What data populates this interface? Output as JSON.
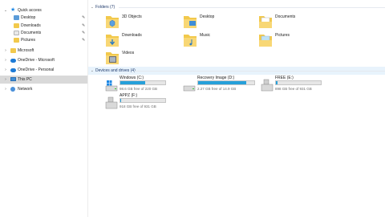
{
  "nav": {
    "quick_access": "Quick access",
    "quick_items": [
      {
        "label": "Desktop",
        "icon": "desktop-folder-icon"
      },
      {
        "label": "Downloads",
        "icon": "downloads-folder-icon"
      },
      {
        "label": "Documents",
        "icon": "documents-folder-icon"
      },
      {
        "label": "Pictures",
        "icon": "pictures-folder-icon"
      }
    ],
    "pin_glyph": "📌",
    "microsoft": "Microsoft",
    "onedrive_microsoft": "OneDrive - Microsoft",
    "onedrive_personal": "OneDrive - Personal",
    "this_pc": "This PC",
    "network": "Network"
  },
  "folders_header": "Folders (7)",
  "folders": [
    {
      "label": "3D Objects",
      "icon": "3d-objects-folder-icon"
    },
    {
      "label": "Desktop",
      "icon": "desktop-folder-icon"
    },
    {
      "label": "Documents",
      "icon": "documents-folder-icon"
    },
    {
      "label": "Downloads",
      "icon": "downloads-folder-icon"
    },
    {
      "label": "Music",
      "icon": "music-folder-icon"
    },
    {
      "label": "Pictures",
      "icon": "pictures-folder-icon"
    },
    {
      "label": "Videos",
      "icon": "videos-folder-icon"
    }
  ],
  "drives_header": "Devices and drives (4)",
  "drives": [
    {
      "name": "Windows (C:)",
      "free": "98.6 GB free of 220 GB",
      "used_fraction": 0.55,
      "color": "#26a0da"
    },
    {
      "name": "Recovery Image (D:)",
      "free": "2.27 GB free of 14.9 GB",
      "used_fraction": 0.85,
      "color": "#26a0da"
    },
    {
      "name": "FREE (E:)",
      "free": "898 GB free of 931 GB",
      "used_fraction": 0.04,
      "color": "#26a0da"
    },
    {
      "name": "APPZ (F:)",
      "free": "918 GB free of 931 GB",
      "used_fraction": 0.02,
      "color": "#26a0da"
    }
  ]
}
